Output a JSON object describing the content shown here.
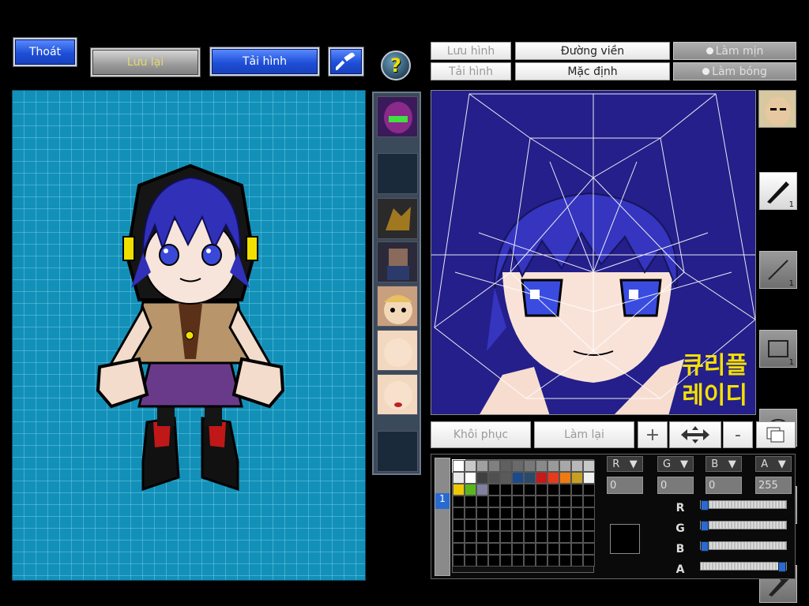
{
  "toolbar_left": {
    "exit_label": "Thoát",
    "save_label": "Lưu lại",
    "load_label": "Tải hình",
    "help_glyph": "?"
  },
  "toolbar_right": {
    "save_image_label": "Lưu hình",
    "load_image_label": "Tải hình",
    "outline_label": "Đường viền",
    "default_label": "Mặc định",
    "smooth_label": "Làm mịn",
    "glossy_label": "Làm bóng"
  },
  "canvas_text": {
    "line1": "큐리플",
    "line2": "레이디"
  },
  "parts_icons": [
    "helmet-icon",
    "empty-slot",
    "dragon-head-icon",
    "outfit-icon",
    "face-icon",
    "face-blank-icon",
    "face-lips-icon",
    "empty-slot"
  ],
  "tools": [
    {
      "name": "pen-tool",
      "count": "1"
    },
    {
      "name": "line-tool",
      "count": "1"
    },
    {
      "name": "rectangle-tool",
      "count": "1"
    },
    {
      "name": "ellipse-tool",
      "count": "1"
    },
    {
      "name": "select-tool",
      "count": ""
    },
    {
      "name": "eyedropper-tool",
      "count": ""
    }
  ],
  "actions": {
    "restore_label": "Khôi phục",
    "redo_label": "Làm lại",
    "plus_label": "+",
    "minus_label": "-"
  },
  "layer_label": "1",
  "channels": {
    "r": {
      "label": "R",
      "value": "0",
      "level": 0
    },
    "g": {
      "label": "G",
      "value": "0",
      "level": 0
    },
    "b": {
      "label": "B",
      "value": "0",
      "level": 0
    },
    "a": {
      "label": "A",
      "value": "255",
      "level": 1
    }
  },
  "palette_colors": [
    "#ffffff",
    "#c8c8c8",
    "#a0a0a0",
    "#808080",
    "#606060",
    "#6a6a6a",
    "#787878",
    "#8a8a8a",
    "#9a9a9a",
    "#a8a8a8",
    "#b8b8b8",
    "#c8c8c8",
    "#e8e8e8",
    "#ffffff",
    "#404040",
    "#505050",
    "#5a5a5a",
    "#1a4a8a",
    "#2a4a6a",
    "#c81818",
    "#e83a18",
    "#f07a10",
    "#c8a020",
    "#f0f0f0",
    "#f0c800",
    "#58b818",
    "#8080a0"
  ],
  "colors": {
    "grid_bg": "#1390b8",
    "canvas_bg": "#241f8a",
    "accent_blue": "#1e4fd8"
  }
}
